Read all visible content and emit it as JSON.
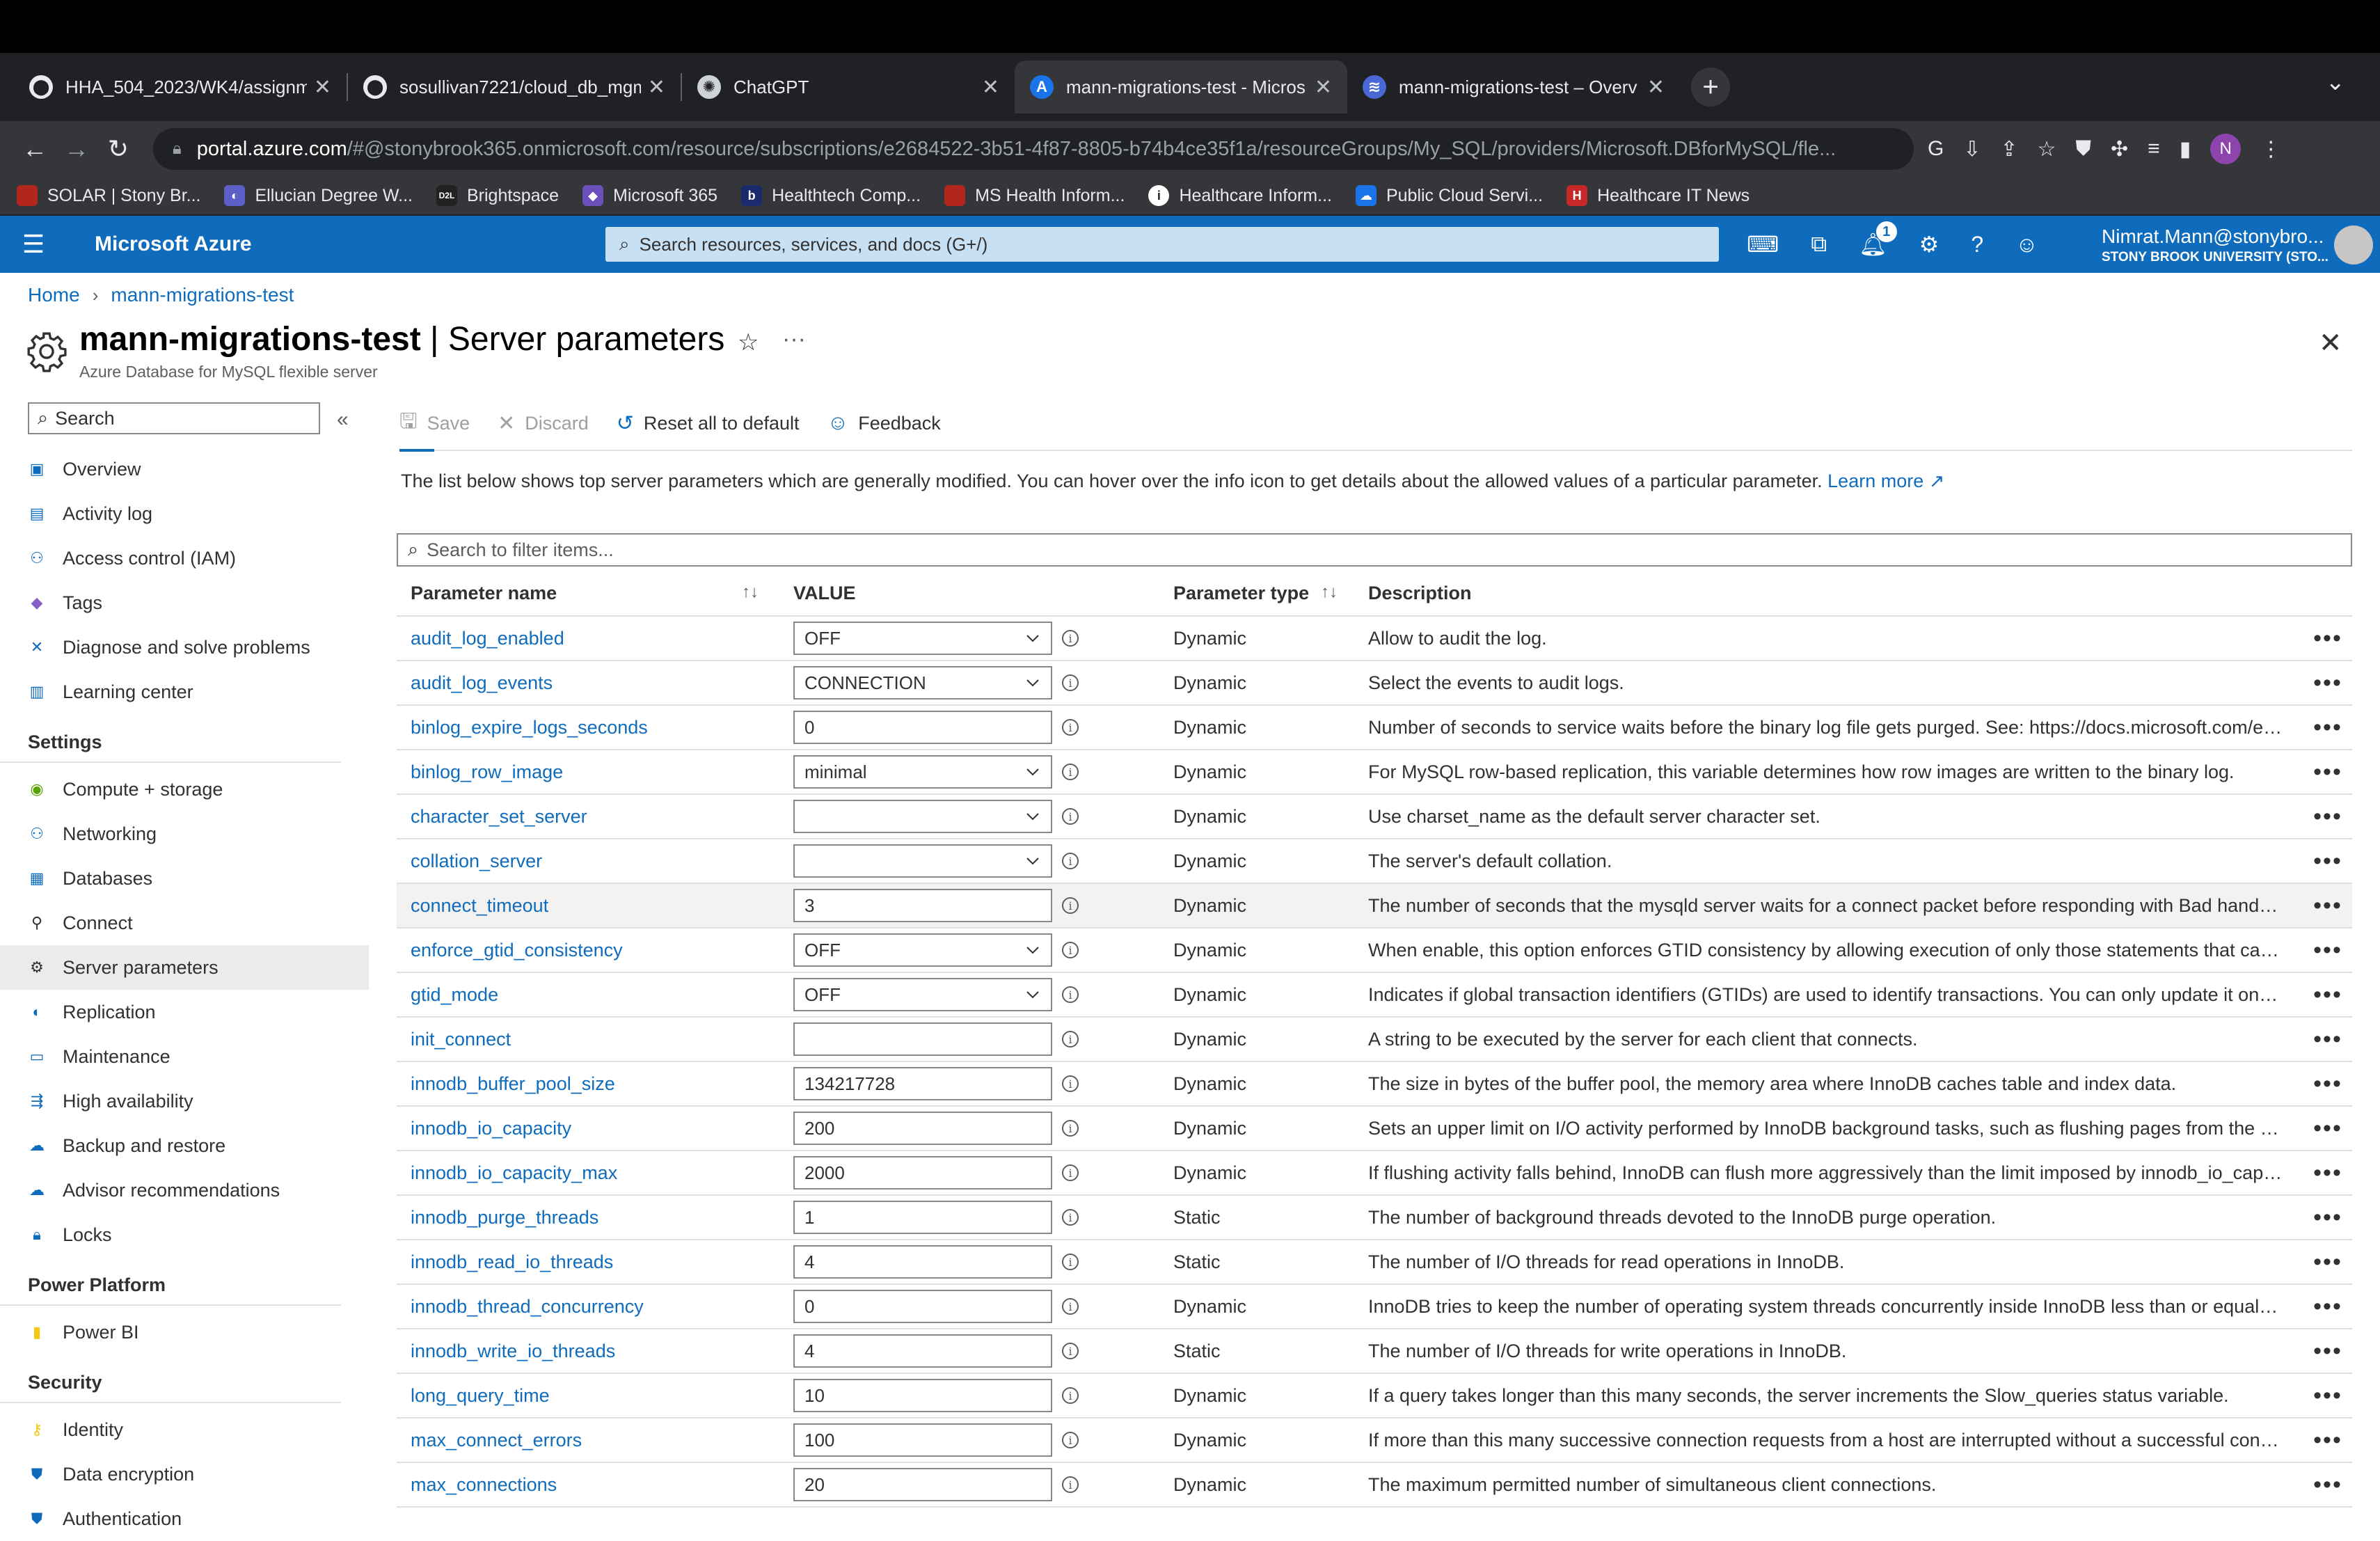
{
  "browser": {
    "tabs": [
      {
        "title": "HHA_504_2023/WK4/assignm",
        "icon": "github-icon",
        "active": false
      },
      {
        "title": "sosullivan7221/cloud_db_mgm",
        "icon": "github-icon",
        "active": false
      },
      {
        "title": "ChatGPT",
        "icon": "chatgpt-icon",
        "active": false
      },
      {
        "title": "mann-migrations-test - Micros",
        "icon": "azure-icon",
        "active": true
      },
      {
        "title": "mann-migrations-test – Overv",
        "icon": "stack-icon",
        "active": false
      }
    ],
    "url_host": "portal.azure.com",
    "url_path": "/#@stonybrook365.onmicrosoft.com/resource/subscriptions/e2684522-3b51-4f87-8805-b74b4ce35f1a/resourceGroups/My_SQL/providers/Microsoft.DBforMySQL/fle...",
    "profile_initial": "N",
    "bookmarks": [
      {
        "label": "SOLAR | Stony Br...",
        "color": "#b3261e",
        "glyph": ""
      },
      {
        "label": "Ellucian Degree W...",
        "color": "#5b5fc7",
        "glyph": "◐"
      },
      {
        "label": "Brightspace",
        "color": "#222222",
        "glyph": "D2L"
      },
      {
        "label": "Microsoft 365",
        "color": "#6b4fbb",
        "glyph": "◆"
      },
      {
        "label": "Healthtech Comp...",
        "color": "#1a2a6c",
        "glyph": "b"
      },
      {
        "label": "MS Health Inform...",
        "color": "#b3261e",
        "glyph": ""
      },
      {
        "label": "Healthcare Inform...",
        "color": "#ffffff",
        "glyph": "i"
      },
      {
        "label": "Public Cloud Servi...",
        "color": "#1a73e8",
        "glyph": "☁"
      },
      {
        "label": "Healthcare IT News",
        "color": "#c62828",
        "glyph": "H"
      }
    ]
  },
  "azure": {
    "brand": "Microsoft Azure",
    "search_placeholder": "Search resources, services, and docs (G+/)",
    "notification_count": "1",
    "account_name": "Nimrat.Mann@stonybro...",
    "account_org": "STONY BROOK UNIVERSITY (STO..."
  },
  "breadcrumb": [
    "Home",
    "mann-migrations-test"
  ],
  "page": {
    "title_resource": "mann-migrations-test",
    "title_section": " | Server parameters",
    "subtitle": "Azure Database for MySQL flexible server"
  },
  "leftnav": {
    "search_placeholder": "Search",
    "groups": [
      {
        "section": "",
        "items": [
          {
            "label": "Overview",
            "icon": "overview-icon",
            "color": "#0f6cbd"
          },
          {
            "label": "Activity log",
            "icon": "activity-log-icon",
            "color": "#0f6cbd"
          },
          {
            "label": "Access control (IAM)",
            "icon": "iam-icon",
            "color": "#0f6cbd"
          },
          {
            "label": "Tags",
            "icon": "tag-icon",
            "color": "#8661c5"
          },
          {
            "label": "Diagnose and solve problems",
            "icon": "diagnose-icon",
            "color": "#0f6cbd"
          },
          {
            "label": "Learning center",
            "icon": "learning-icon",
            "color": "#0f6cbd"
          }
        ]
      },
      {
        "section": "Settings",
        "items": [
          {
            "label": "Compute + storage",
            "icon": "compute-icon",
            "color": "#57a300"
          },
          {
            "label": "Networking",
            "icon": "networking-icon",
            "color": "#0f6cbd"
          },
          {
            "label": "Databases",
            "icon": "database-icon",
            "color": "#0f6cbd"
          },
          {
            "label": "Connect",
            "icon": "connect-icon",
            "color": "#323130"
          },
          {
            "label": "Server parameters",
            "icon": "gear-icon",
            "color": "#323130",
            "selected": true
          },
          {
            "label": "Replication",
            "icon": "replication-icon",
            "color": "#0f6cbd"
          },
          {
            "label": "Maintenance",
            "icon": "maintenance-icon",
            "color": "#0f6cbd"
          },
          {
            "label": "High availability",
            "icon": "ha-icon",
            "color": "#0f6cbd"
          },
          {
            "label": "Backup and restore",
            "icon": "backup-icon",
            "color": "#0f6cbd"
          },
          {
            "label": "Advisor recommendations",
            "icon": "advisor-icon",
            "color": "#0f6cbd"
          },
          {
            "label": "Locks",
            "icon": "lock-icon",
            "color": "#0f6cbd"
          }
        ]
      },
      {
        "section": "Power Platform",
        "items": [
          {
            "label": "Power BI",
            "icon": "powerbi-icon",
            "color": "#f2c811"
          }
        ]
      },
      {
        "section": "Security",
        "items": [
          {
            "label": "Identity",
            "icon": "identity-icon",
            "color": "#f2c811"
          },
          {
            "label": "Data encryption",
            "icon": "encryption-icon",
            "color": "#0f6cbd"
          },
          {
            "label": "Authentication",
            "icon": "authentication-icon",
            "color": "#0f6cbd"
          }
        ]
      }
    ]
  },
  "commands": {
    "save": "Save",
    "discard": "Discard",
    "reset": "Reset all to default",
    "feedback": "Feedback"
  },
  "info_text": "The list below shows top server parameters which are generally modified. You can hover over the info icon to get details about the allowed values of a particular parameter.",
  "learn_more": "Learn more",
  "filter_placeholder": "Search to filter items...",
  "grid": {
    "headers": {
      "name": "Parameter name",
      "value": "VALUE",
      "type": "Parameter type",
      "desc": "Description"
    },
    "rows": [
      {
        "name": "audit_log_enabled",
        "value": "OFF",
        "kind": "dropdown",
        "type": "Dynamic",
        "desc": "Allow to audit the log."
      },
      {
        "name": "audit_log_events",
        "value": "CONNECTION",
        "kind": "dropdown",
        "type": "Dynamic",
        "desc": "Select the events to audit logs."
      },
      {
        "name": "binlog_expire_logs_seconds",
        "value": "0",
        "kind": "text",
        "type": "Dynamic",
        "desc": "Number of seconds to service waits before the binary log file gets purged. See: https://docs.microsoft.com/en-us/az..."
      },
      {
        "name": "binlog_row_image",
        "value": "minimal",
        "kind": "dropdown",
        "type": "Dynamic",
        "desc": "For MySQL row-based replication, this variable determines how row images are written to the binary log."
      },
      {
        "name": "character_set_server",
        "value": "",
        "kind": "dropdown",
        "type": "Dynamic",
        "desc": "Use charset_name as the default server character set."
      },
      {
        "name": "collation_server",
        "value": "",
        "kind": "dropdown",
        "type": "Dynamic",
        "desc": "The server's default collation."
      },
      {
        "name": "connect_timeout",
        "value": "3",
        "kind": "text",
        "type": "Dynamic",
        "desc": "The number of seconds that the mysqld server waits for a connect packet before responding with Bad handshake.",
        "hover": true
      },
      {
        "name": "enforce_gtid_consistency",
        "value": "OFF",
        "kind": "dropdown",
        "type": "Dynamic",
        "desc": "When enable, this option enforces GTID consistency by allowing execution of only those statements that can be log..."
      },
      {
        "name": "gtid_mode",
        "value": "OFF",
        "kind": "dropdown",
        "type": "Dynamic",
        "desc": "Indicates if global transaction identifiers (GTIDs) are used to identify transactions. You can only update it one step at..."
      },
      {
        "name": "init_connect",
        "value": "",
        "kind": "text",
        "type": "Dynamic",
        "desc": "A string to be executed by the server for each client that connects."
      },
      {
        "name": "innodb_buffer_pool_size",
        "value": "134217728",
        "kind": "text",
        "type": "Dynamic",
        "desc": "The size in bytes of the buffer pool, the memory area where InnoDB caches table and index data."
      },
      {
        "name": "innodb_io_capacity",
        "value": "200",
        "kind": "text",
        "type": "Dynamic",
        "desc": "Sets an upper limit on I/O activity performed by InnoDB background tasks, such as flushing pages from the buffer p..."
      },
      {
        "name": "innodb_io_capacity_max",
        "value": "2000",
        "kind": "text",
        "type": "Dynamic",
        "desc": "If flushing activity falls behind, InnoDB can flush more aggressively than the limit imposed by innodb_io_capacity. in..."
      },
      {
        "name": "innodb_purge_threads",
        "value": "1",
        "kind": "text",
        "type": "Static",
        "desc": "The number of background threads devoted to the InnoDB purge operation."
      },
      {
        "name": "innodb_read_io_threads",
        "value": "4",
        "kind": "text",
        "type": "Static",
        "desc": "The number of I/O threads for read operations in InnoDB."
      },
      {
        "name": "innodb_thread_concurrency",
        "value": "0",
        "kind": "text",
        "type": "Dynamic",
        "desc": "InnoDB tries to keep the number of operating system threads concurrently inside InnoDB less than or equal to the li..."
      },
      {
        "name": "innodb_write_io_threads",
        "value": "4",
        "kind": "text",
        "type": "Static",
        "desc": "The number of I/O threads for write operations in InnoDB."
      },
      {
        "name": "long_query_time",
        "value": "10",
        "kind": "text",
        "type": "Dynamic",
        "desc": "If a query takes longer than this many seconds, the server increments the Slow_queries status variable."
      },
      {
        "name": "max_connect_errors",
        "value": "100",
        "kind": "text",
        "type": "Dynamic",
        "desc": "If more than this many successive connection requests from a host are interrupted without a successful connection, ..."
      },
      {
        "name": "max_connections",
        "value": "20",
        "kind": "text",
        "type": "Dynamic",
        "desc": "The maximum permitted number of simultaneous client connections."
      }
    ]
  }
}
